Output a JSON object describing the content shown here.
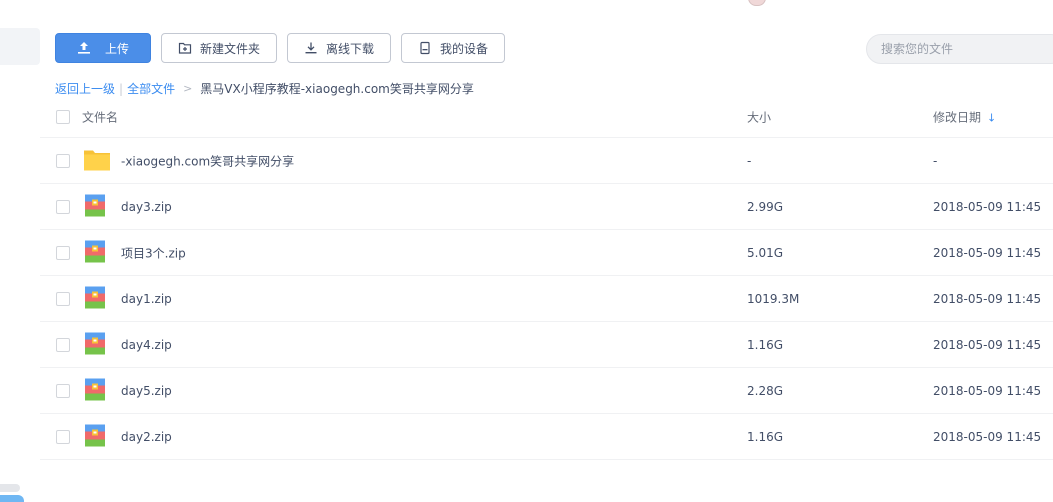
{
  "toolbar": {
    "upload_label": "上传",
    "new_folder_label": "新建文件夹",
    "offline_download_label": "离线下载",
    "my_devices_label": "我的设备"
  },
  "search": {
    "placeholder": "搜索您的文件"
  },
  "breadcrumb": {
    "back": "返回上一级",
    "separator": "|",
    "all_files": "全部文件",
    "arrow": ">",
    "current": "黑马VX小程序教程-xiaogegh.com笑哥共享网分享"
  },
  "table": {
    "headers": {
      "name": "文件名",
      "size": "大小",
      "modified": "修改日期",
      "sort_arrow": "↓"
    },
    "rows": [
      {
        "type": "folder",
        "name": "-xiaogegh.com笑哥共享网分享",
        "size": "-",
        "modified": "-"
      },
      {
        "type": "zip",
        "name": "day3.zip",
        "size": "2.99G",
        "modified": "2018-05-09 11:45"
      },
      {
        "type": "zip",
        "name": "项目3个.zip",
        "size": "5.01G",
        "modified": "2018-05-09 11:45"
      },
      {
        "type": "zip",
        "name": "day1.zip",
        "size": "1019.3M",
        "modified": "2018-05-09 11:45"
      },
      {
        "type": "zip",
        "name": "day4.zip",
        "size": "1.16G",
        "modified": "2018-05-09 11:45"
      },
      {
        "type": "zip",
        "name": "day5.zip",
        "size": "2.28G",
        "modified": "2018-05-09 11:45"
      },
      {
        "type": "zip",
        "name": "day2.zip",
        "size": "1.16G",
        "modified": "2018-05-09 11:45"
      }
    ]
  },
  "colors": {
    "accent": "#4b8ee8",
    "link": "#3b8cf0",
    "folder": "#ffd24a",
    "text": "#424e67"
  }
}
